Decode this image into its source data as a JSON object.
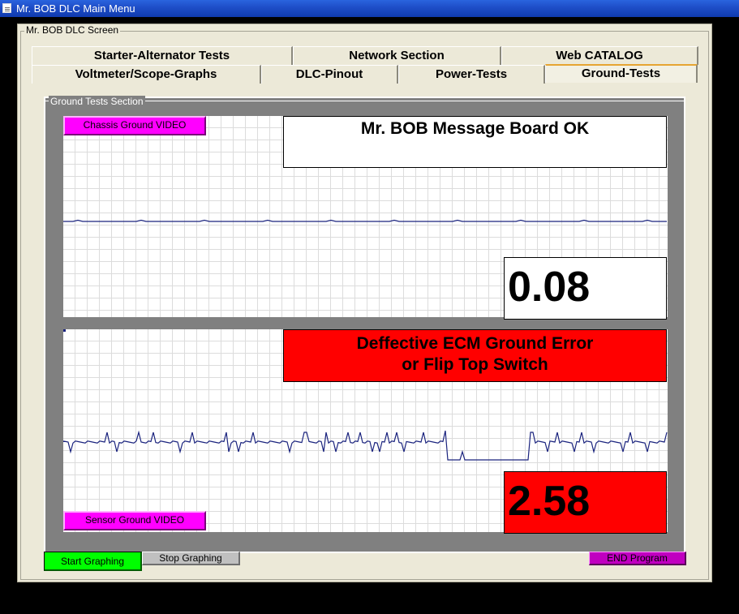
{
  "window": {
    "title": "Mr. BOB DLC Main Menu"
  },
  "screen": {
    "legend": "Mr. BOB DLC Screen"
  },
  "tabs": {
    "row1": [
      "Starter-Alternator Tests",
      "Network Section",
      "Web CATALOG"
    ],
    "row2": [
      "Voltmeter/Scope-Graphs",
      "DLC-Pinout",
      "Power-Tests",
      "Ground-Tests"
    ],
    "active": "Ground-Tests"
  },
  "section": {
    "legend": "Ground Tests Section"
  },
  "chassis": {
    "video_button": "Chassis Ground VIDEO",
    "message": "Mr. BOB Message Board OK",
    "value": "0.08",
    "value_bg": "#ffffff",
    "trace_color": "#1a237e"
  },
  "sensor": {
    "video_button": "Sensor Ground VIDEO",
    "message_line1": "Deffective ECM Ground Error",
    "message_line2": "or Flip Top Switch",
    "message_bg": "#ff0000",
    "value": "2.58",
    "value_bg": "#ff0000",
    "trace_color": "#1a237e"
  },
  "buttons": {
    "start": "Start Graphing",
    "start_bg": "#00ff00",
    "stop": "Stop Graphing",
    "stop_bg": "#c0c0c0",
    "end": "END Program",
    "end_bg": "#c000c0"
  }
}
